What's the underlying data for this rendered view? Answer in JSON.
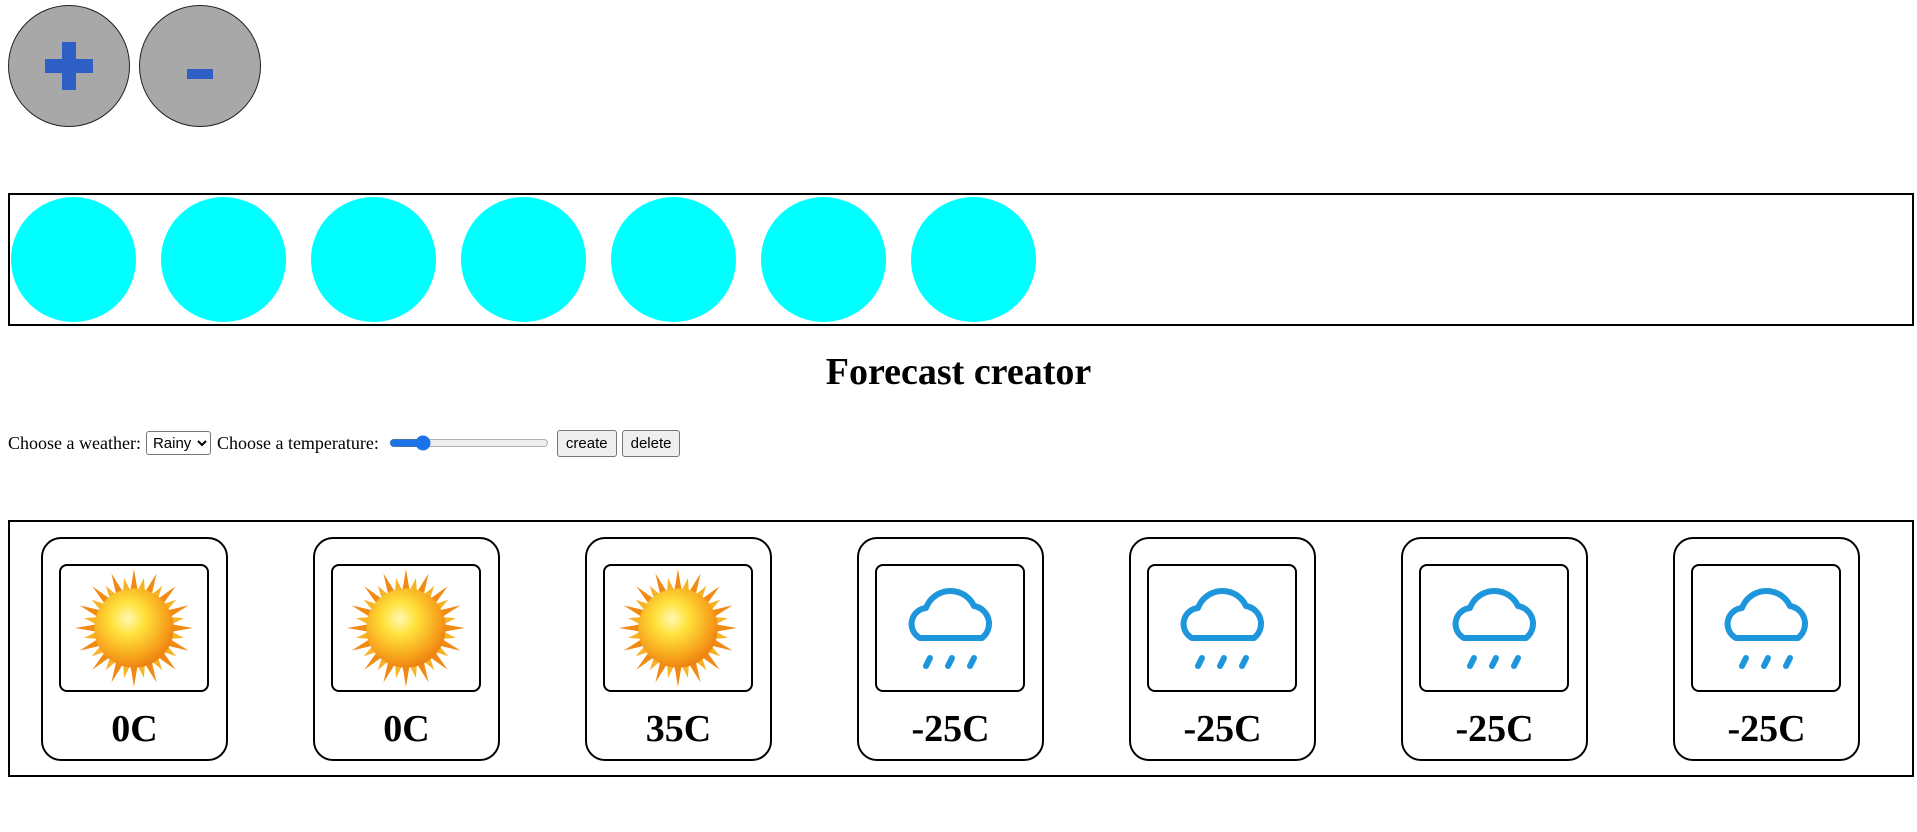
{
  "zoom_controls": {
    "plus_label": "+",
    "minus_label": "-"
  },
  "circles": {
    "count": 7,
    "color": "#00ffff"
  },
  "title": "Forecast creator",
  "controls": {
    "weather_label": "Choose a weather:",
    "weather_options": [
      "Rainy"
    ],
    "weather_selected": "Rainy",
    "temperature_label": "Choose a temperature:",
    "temperature_slider_fraction": 0.18,
    "create_label": "create",
    "delete_label": "delete",
    "slider_color": "#1a73e8"
  },
  "forecast": [
    {
      "weather": "sunny",
      "icon": "sun-icon",
      "temp": "0C"
    },
    {
      "weather": "sunny",
      "icon": "sun-icon",
      "temp": "0C"
    },
    {
      "weather": "sunny",
      "icon": "sun-icon",
      "temp": "35C"
    },
    {
      "weather": "rainy",
      "icon": "rain-cloud-icon",
      "temp": "-25C"
    },
    {
      "weather": "rainy",
      "icon": "rain-cloud-icon",
      "temp": "-25C"
    },
    {
      "weather": "rainy",
      "icon": "rain-cloud-icon",
      "temp": "-25C"
    },
    {
      "weather": "rainy",
      "icon": "rain-cloud-icon",
      "temp": "-25C"
    }
  ],
  "colors": {
    "button_gray": "#a8a8a8",
    "symbol_blue": "#2f5ec4",
    "rain_blue": "#1e96dc"
  }
}
